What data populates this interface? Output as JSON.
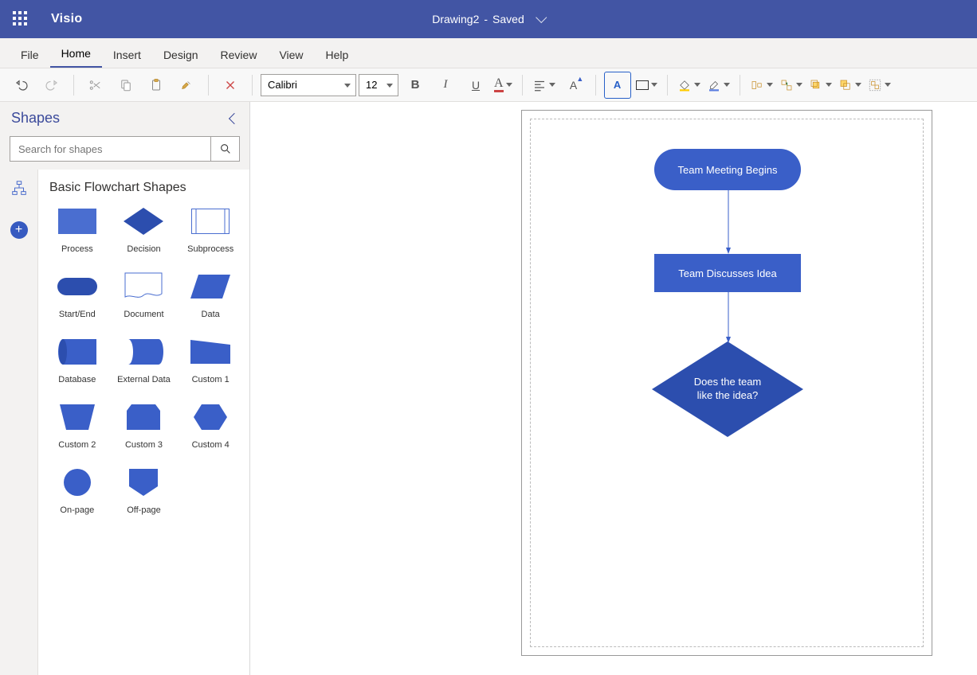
{
  "titlebar": {
    "app_name": "Visio",
    "doc_name": "Drawing2",
    "doc_status_sep": "-",
    "doc_status": "Saved"
  },
  "tabs": {
    "file": "File",
    "home": "Home",
    "insert": "Insert",
    "design": "Design",
    "review": "Review",
    "view": "View",
    "help": "Help"
  },
  "ribbon": {
    "font_name": "Calibri",
    "font_size": "12"
  },
  "shapes": {
    "panel_title": "Shapes",
    "search_placeholder": "Search for shapes",
    "stencil_title": "Basic Flowchart Shapes",
    "items": [
      {
        "label": "Process"
      },
      {
        "label": "Decision"
      },
      {
        "label": "Subprocess"
      },
      {
        "label": "Start/End"
      },
      {
        "label": "Document"
      },
      {
        "label": "Data"
      },
      {
        "label": "Database"
      },
      {
        "label": "External Data"
      },
      {
        "label": "Custom 1"
      },
      {
        "label": "Custom 2"
      },
      {
        "label": "Custom 3"
      },
      {
        "label": "Custom 4"
      },
      {
        "label": "On-page"
      },
      {
        "label": "Off-page"
      }
    ]
  },
  "flowchart": {
    "node1": "Team Meeting Begins",
    "node2": "Team Discusses Idea",
    "node3a": "Does the team",
    "node3b": "like the idea?"
  },
  "colors": {
    "brand": "#4255a4",
    "shape_fill": "#3a5fc8",
    "shape_dark": "#2c4eae"
  }
}
